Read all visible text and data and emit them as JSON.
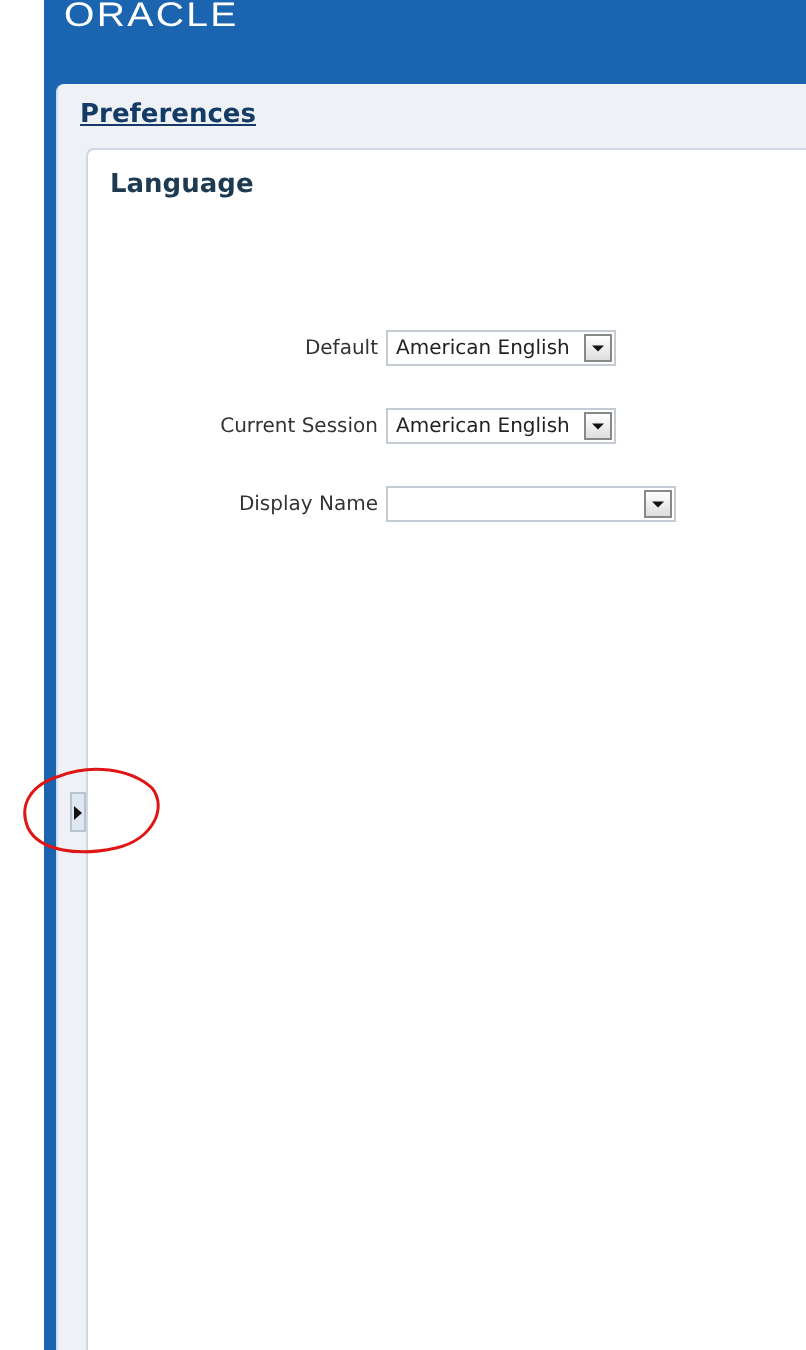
{
  "header": {
    "logo": "ORACLE"
  },
  "panel": {
    "title": "Preferences"
  },
  "section": {
    "title": "Language",
    "fields": [
      {
        "label": "Default",
        "value": "American English",
        "kind": "short"
      },
      {
        "label": "Current Session",
        "value": "American English",
        "kind": "short"
      },
      {
        "label": "Display Name",
        "kind": "wide"
      }
    ]
  }
}
